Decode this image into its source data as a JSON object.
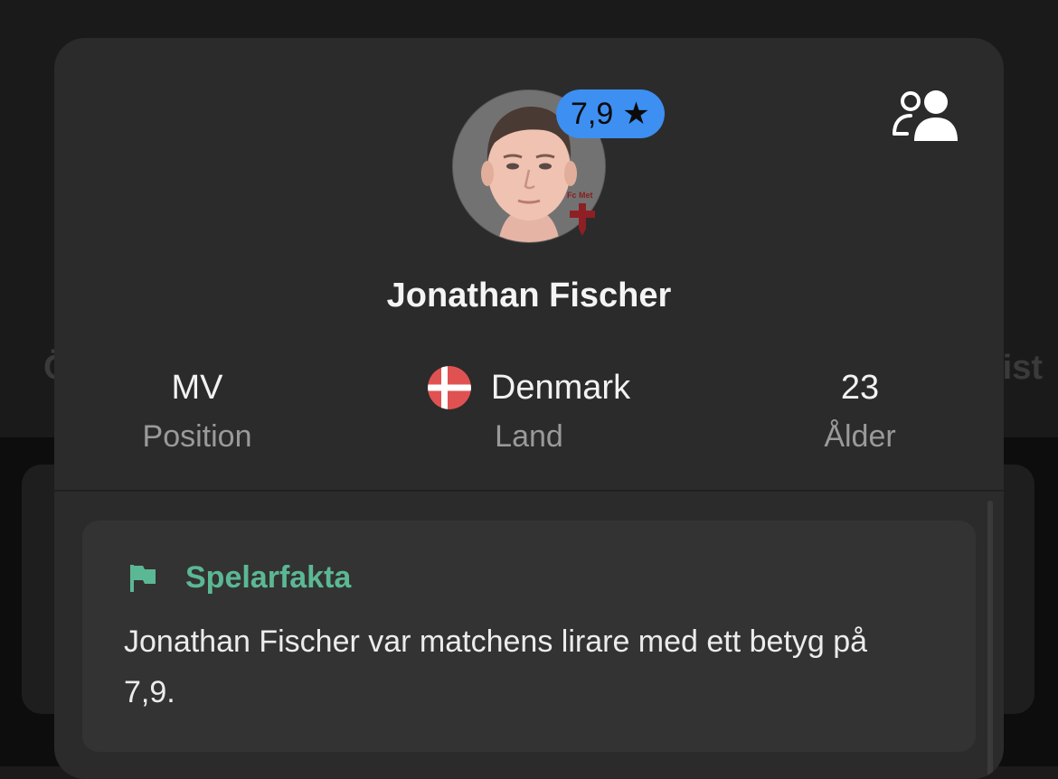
{
  "background": {
    "tab_left": "Ö",
    "tab_right": "tist"
  },
  "player": {
    "name": "Jonathan Fischer",
    "rating": "7,9",
    "club_badge_text": "Fc Met"
  },
  "stats": [
    {
      "value": "MV",
      "label": "Position"
    },
    {
      "value": "Denmark",
      "label": "Land",
      "flag": "denmark-flag-icon"
    },
    {
      "value": "23",
      "label": "Ålder"
    }
  ],
  "fact": {
    "title": "Spelarfakta",
    "text": "Jonathan Fischer var matchens lirare med ett betyg på 7,9."
  },
  "colors": {
    "badge": "#3d8ff2",
    "fact_accent": "#5bb894",
    "sheet": "#2b2b2b",
    "flag_red": "#e05252"
  }
}
